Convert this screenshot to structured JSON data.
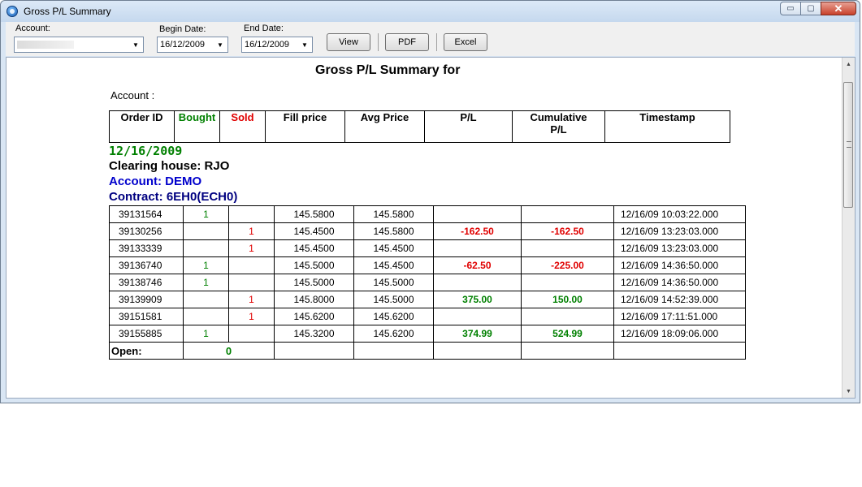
{
  "window": {
    "title": "Gross P/L Summary",
    "controls": {
      "minimize": "▭",
      "maximize": "▢",
      "close": "✕"
    }
  },
  "toolbar": {
    "account_label": "Account:",
    "account_value": "",
    "begin_date_label": "Begin Date:",
    "begin_date_value": "16/12/2009",
    "end_date_label": "End Date:",
    "end_date_value": "16/12/2009",
    "view_label": "View",
    "pdf_label": "PDF",
    "excel_label": "Excel"
  },
  "report": {
    "title": "Gross P/L Summary for",
    "account_line": "Account :",
    "headers": {
      "order_id": "Order ID",
      "bought": "Bought",
      "sold": "Sold",
      "fill_price": "Fill price",
      "avg_price": "Avg Price",
      "pl": "P/L",
      "cumulative_pl": "Cumulative P/L",
      "timestamp": "Timestamp"
    },
    "group": {
      "date": "12/16/2009",
      "clearing_house": "Clearing house: RJO",
      "account": "Account: DEMO",
      "contract": "Contract: 6EH0(ECH0)"
    },
    "rows": [
      {
        "order_id": "39131564",
        "bought": "1",
        "sold": "",
        "fill_price": "145.5800",
        "avg_price": "145.5800",
        "pl": "",
        "cum_pl": "",
        "timestamp": "12/16/09 10:03:22.000"
      },
      {
        "order_id": "39130256",
        "bought": "",
        "sold": "1",
        "fill_price": "145.4500",
        "avg_price": "145.5800",
        "pl": "-162.50",
        "cum_pl": "-162.50",
        "timestamp": "12/16/09 13:23:03.000"
      },
      {
        "order_id": "39133339",
        "bought": "",
        "sold": "1",
        "fill_price": "145.4500",
        "avg_price": "145.4500",
        "pl": "",
        "cum_pl": "",
        "timestamp": "12/16/09 13:23:03.000"
      },
      {
        "order_id": "39136740",
        "bought": "1",
        "sold": "",
        "fill_price": "145.5000",
        "avg_price": "145.4500",
        "pl": "-62.50",
        "cum_pl": "-225.00",
        "timestamp": "12/16/09 14:36:50.000"
      },
      {
        "order_id": "39138746",
        "bought": "1",
        "sold": "",
        "fill_price": "145.5000",
        "avg_price": "145.5000",
        "pl": "",
        "cum_pl": "",
        "timestamp": "12/16/09 14:36:50.000"
      },
      {
        "order_id": "39139909",
        "bought": "",
        "sold": "1",
        "fill_price": "145.8000",
        "avg_price": "145.5000",
        "pl": "375.00",
        "cum_pl": "150.00",
        "timestamp": "12/16/09 14:52:39.000"
      },
      {
        "order_id": "39151581",
        "bought": "",
        "sold": "1",
        "fill_price": "145.6200",
        "avg_price": "145.6200",
        "pl": "",
        "cum_pl": "",
        "timestamp": "12/16/09 17:11:51.000"
      },
      {
        "order_id": "39155885",
        "bought": "1",
        "sold": "",
        "fill_price": "145.3200",
        "avg_price": "145.6200",
        "pl": "374.99",
        "cum_pl": "524.99",
        "timestamp": "12/16/09 18:09:06.000"
      }
    ],
    "open_label": "Open:",
    "open_value": "0"
  },
  "colors": {
    "bought": "#008000",
    "sold": "#e00000",
    "account": "#0000cc",
    "contract": "#000080"
  }
}
